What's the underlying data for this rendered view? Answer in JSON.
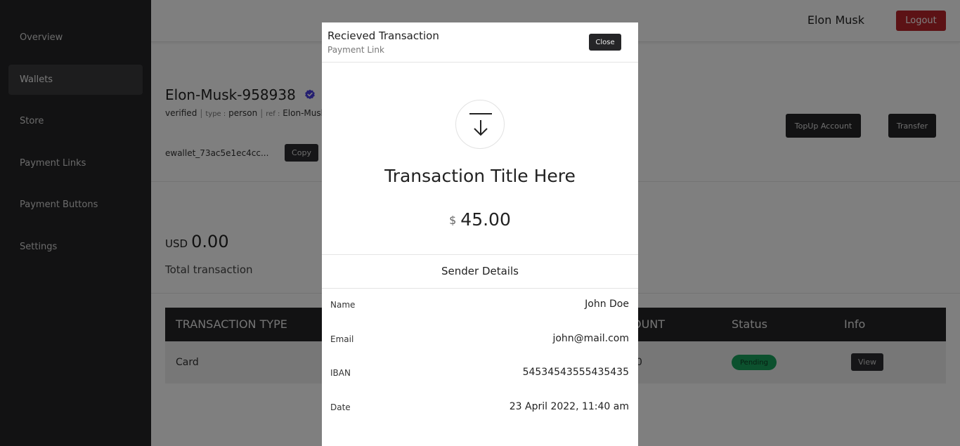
{
  "sidebar": {
    "items": [
      {
        "label": "Overview",
        "active": false
      },
      {
        "label": "Wallets",
        "active": true
      },
      {
        "label": "Store",
        "active": false
      },
      {
        "label": "Payment Links",
        "active": false
      },
      {
        "label": "Payment Buttons",
        "active": false
      },
      {
        "label": "Settings",
        "active": false
      }
    ]
  },
  "header": {
    "user_name": "Elon Musk",
    "logout_label": "Logout"
  },
  "wallet": {
    "name": "Elon-Musk-958938",
    "status": "verified",
    "type_label": "type :",
    "type_value": "person",
    "ref_label": "ref :",
    "ref_value": "Elon-Musk-",
    "id": "ewallet_73ac5e1ec4cc...",
    "copy_label": "Copy",
    "topup_label": "TopUp Account",
    "transfer_label": "Transfer",
    "currency": "USD",
    "balance": "0.00",
    "total_label": "Total transaction"
  },
  "table": {
    "headers": {
      "type": "TRANSACTION TYPE",
      "amount": "OUNT",
      "status": "Status",
      "info": "Info"
    },
    "rows": [
      {
        "type": "Card",
        "amount": "0",
        "status": "Pending",
        "info": "View"
      }
    ]
  },
  "modal": {
    "title": "Recieved Transaction",
    "subtitle": "Payment Link",
    "close_label": "Close",
    "tx_title": "Transaction Title Here",
    "currency_symbol": "$",
    "amount": "45.00",
    "sender_heading": "Sender Details",
    "details": [
      {
        "label": "Name",
        "value": "John Doe"
      },
      {
        "label": "Email",
        "value": "john@mail.com"
      },
      {
        "label": "IBAN",
        "value": "54534543555435435"
      },
      {
        "label": "Date",
        "value": "23 April 2022, 11:40 am"
      }
    ]
  },
  "colors": {
    "sidebar_bg": "#252527",
    "logout_red": "#b9252a",
    "status_green": "#18a35c",
    "verified_blue": "#4a3fe0"
  },
  "icons": {
    "verified": "verified-badge-icon",
    "download": "download-arrow-icon"
  }
}
